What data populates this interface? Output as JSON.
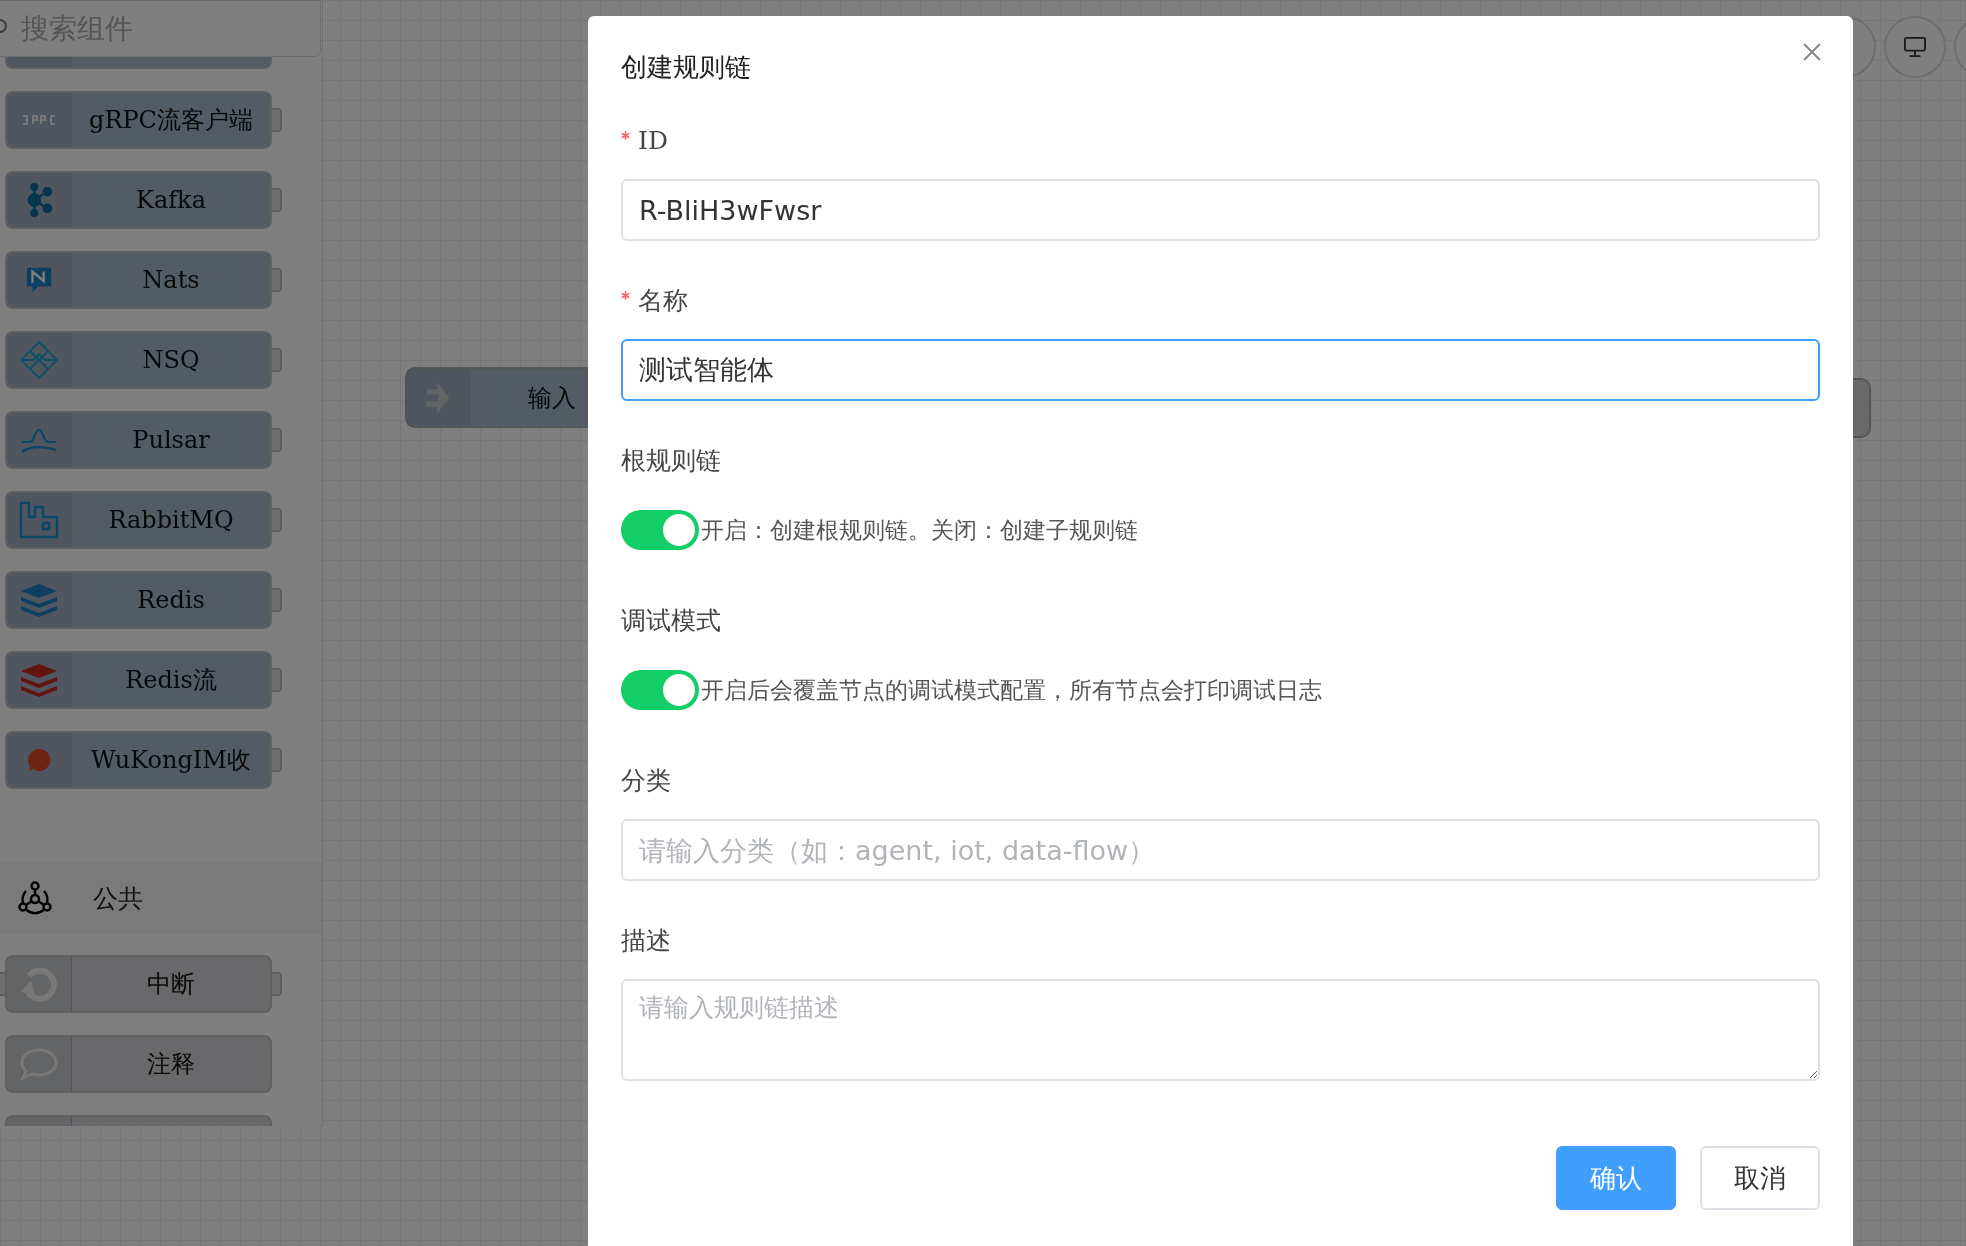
{
  "sidebar": {
    "search": {
      "placeholder": "搜索组件"
    },
    "groups": [
      {
        "nodes": [
          {
            "label": "gRPC流客户端",
            "in_port": false,
            "out_port": true
          },
          {
            "label": "Kafka",
            "in_port": false,
            "out_port": true
          },
          {
            "label": "Nats",
            "in_port": false,
            "out_port": true
          },
          {
            "label": "NSQ",
            "in_port": false,
            "out_port": true
          },
          {
            "label": "Pulsar",
            "in_port": false,
            "out_port": true
          },
          {
            "label": "RabbitMQ",
            "in_port": false,
            "out_port": true
          },
          {
            "label": "Redis",
            "in_port": false,
            "out_port": true
          },
          {
            "label": "Redis流",
            "in_port": false,
            "out_port": true
          },
          {
            "label": "WuKongIM收",
            "in_port": false,
            "out_port": true
          }
        ]
      },
      {
        "title": "公共",
        "nodes": [
          {
            "label": "中断",
            "in_port": true,
            "out_port": true
          },
          {
            "label": "注释",
            "in_port": false,
            "out_port": false
          }
        ]
      }
    ]
  },
  "canvas": {
    "nodes": [
      {
        "label": "输入"
      }
    ]
  },
  "dialog": {
    "title": "创建规则链",
    "fields": [
      {
        "kind": "input",
        "label": "ID",
        "required": true,
        "value": "R-BliH3wFwsr",
        "focused": false
      },
      {
        "kind": "input",
        "label": "名称",
        "required": true,
        "value": "测试智能体",
        "focused": true
      },
      {
        "kind": "switch",
        "label": "根规则链",
        "on": true,
        "hint": "开启：创建根规则链。关闭：创建子规则链"
      },
      {
        "kind": "switch",
        "label": "调试模式",
        "on": true,
        "hint": "开启后会覆盖节点的调试模式配置，所有节点会打印调试日志"
      },
      {
        "kind": "input",
        "label": "分类",
        "required": false,
        "placeholder": "请输入分类（如：agent, iot, data-flow）",
        "focused": false
      },
      {
        "kind": "textarea",
        "label": "描述",
        "required": false,
        "placeholder": "请输入规则链描述"
      }
    ],
    "buttons": [
      {
        "label": "确认",
        "kind": "primary"
      },
      {
        "label": "取消",
        "kind": "default"
      }
    ]
  }
}
